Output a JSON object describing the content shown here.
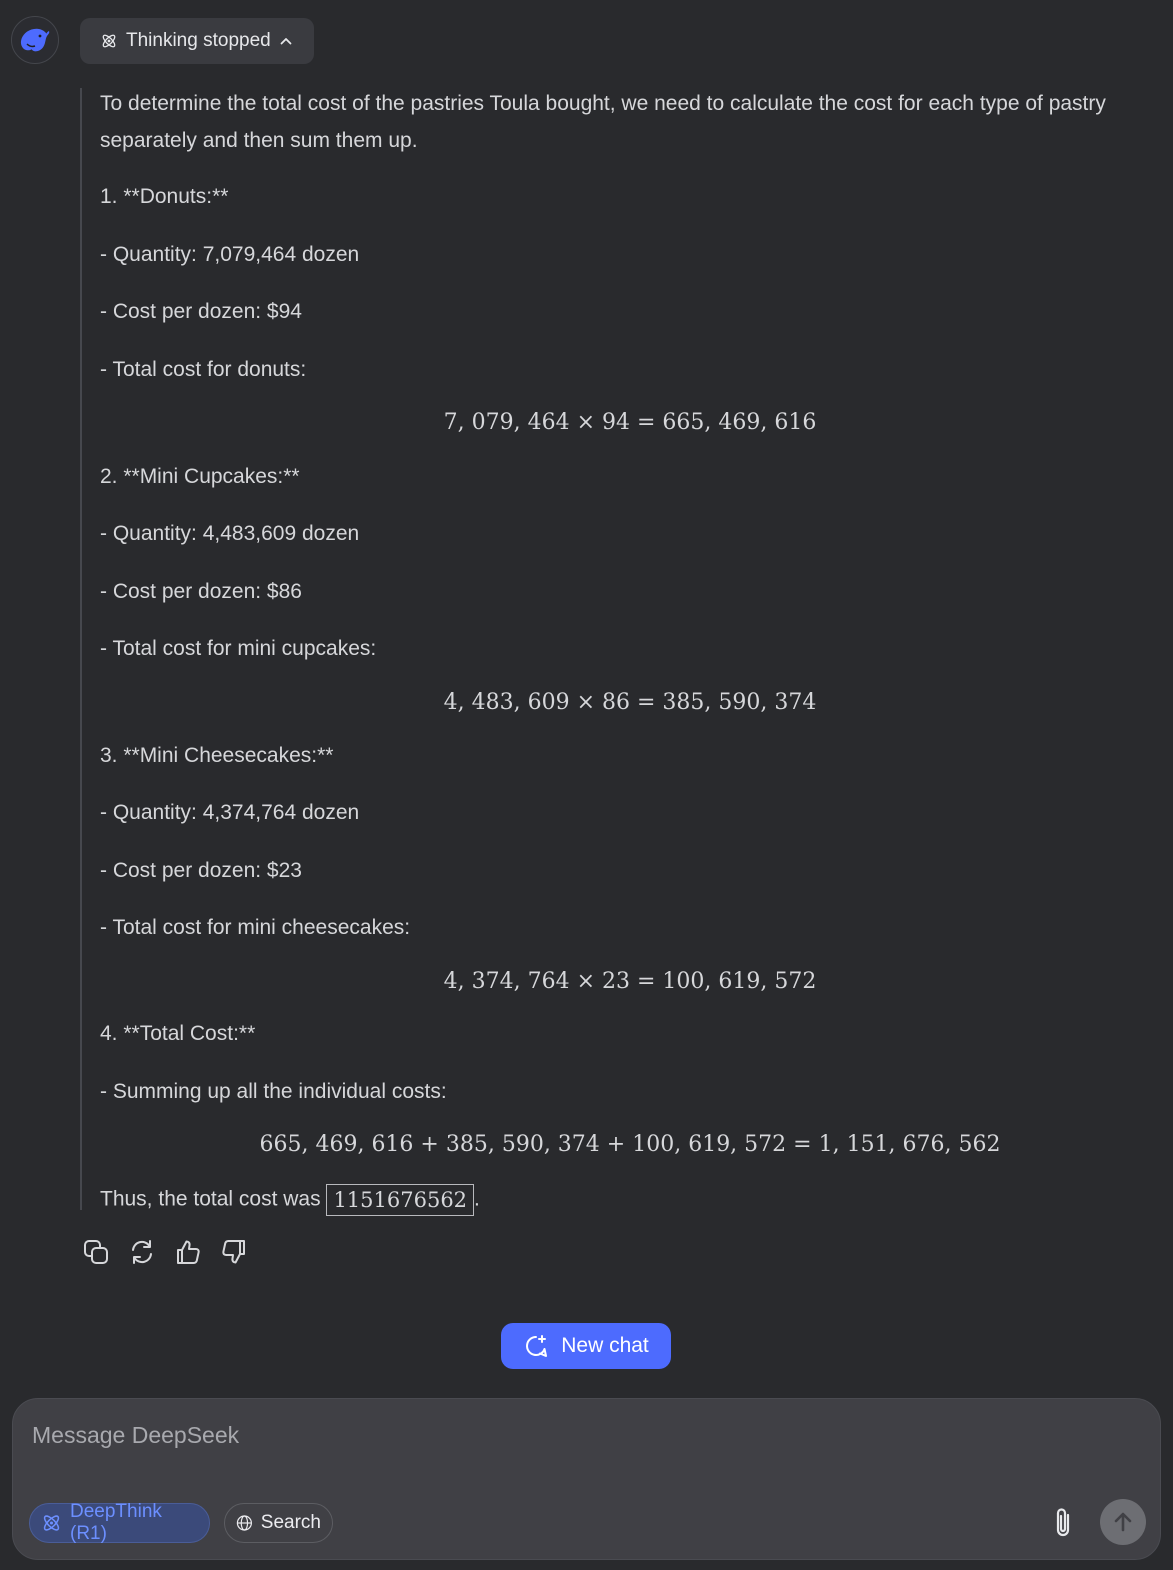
{
  "thinking": {
    "label": "Thinking stopped"
  },
  "answer": {
    "intro": "To determine the total cost of the pastries Toula bought, we need to calculate the cost for each type of pastry separately and then sum them up.",
    "donuts": {
      "heading": "1. **Donuts:**",
      "quantity": "- Quantity: 7,079,464 dozen",
      "cost": "- Cost per dozen: $94",
      "total_label": "- Total cost for donuts:",
      "equation": "7, 079, 464 × 94 = 665, 469, 616"
    },
    "cupcakes": {
      "heading": "2. **Mini Cupcakes:**",
      "quantity": "- Quantity: 4,483,609 dozen",
      "cost": "- Cost per dozen: $86",
      "total_label": "- Total cost for mini cupcakes:",
      "equation": "4, 483, 609 × 86 = 385, 590, 374"
    },
    "cheesecakes": {
      "heading": "3. **Mini Cheesecakes:**",
      "quantity": "- Quantity: 4,374,764 dozen",
      "cost": "- Cost per dozen: $23",
      "total_label": "- Total cost for mini cheesecakes:",
      "equation": "4, 374, 764 × 23 = 100, 619, 572"
    },
    "total": {
      "heading": "4. **Total Cost:**",
      "summing": "- Summing up all the individual costs:",
      "equation": "665, 469, 616 + 385, 590, 374 + 100, 619, 572 = 1, 151, 676, 562"
    },
    "conclusion_prefix": "Thus, the total cost was ",
    "boxed_answer": "1151676562",
    "conclusion_suffix": "."
  },
  "actions": {
    "icons": [
      "copy-icon",
      "regenerate-icon",
      "thumbs-up-icon",
      "thumbs-down-icon"
    ]
  },
  "new_chat": {
    "label": "New chat"
  },
  "composer": {
    "placeholder": "Message DeepSeek",
    "deepthink_label": "DeepThink (R1)",
    "search_label": "Search"
  },
  "colors": {
    "background": "#292a2d",
    "accent": "#4d6bfe",
    "deepthink_text": "#6c8fff",
    "composer_bg": "#404045"
  }
}
